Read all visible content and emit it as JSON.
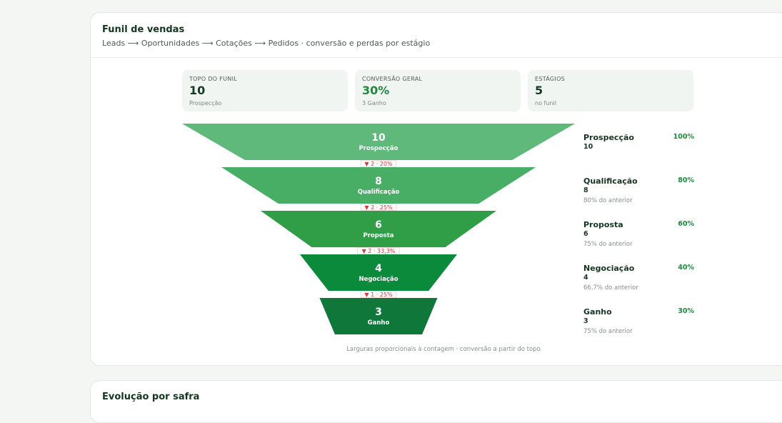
{
  "card": {
    "title": "Funil de vendas",
    "subtitle": "Leads ⟶ Oportunidades ⟶ Cotações ⟶ Pedidos · conversão e perdas por estágio"
  },
  "stats": [
    {
      "label": "TOPO DO FUNIL",
      "value": "10",
      "note": "Prospecção"
    },
    {
      "label": "CONVERSÃO GERAL",
      "value": "30%",
      "note": "3 Ganho"
    },
    {
      "label": "ESTÁGIOS",
      "value": "5",
      "note": "no funil"
    }
  ],
  "footnote": "Larguras proporcionais à contagem · conversão a partir do topo",
  "next_card": {
    "title": "Evolução por safra"
  },
  "chart_data": {
    "type": "funnel",
    "stages": [
      {
        "name": "Prospecção",
        "value": 10,
        "pct_of_top": "100%",
        "note": "",
        "color": "#5fb97a"
      },
      {
        "name": "Qualificação",
        "value": 8,
        "pct_of_top": "80%",
        "note": "80% do anterior",
        "color": "#48ae66"
      },
      {
        "name": "Proposta",
        "value": 6,
        "pct_of_top": "60%",
        "note": "75% do anterior",
        "color": "#2f9e47"
      },
      {
        "name": "Negociação",
        "value": 4,
        "pct_of_top": "40%",
        "note": "66,7% do anterior",
        "color": "#0b8a3b"
      },
      {
        "name": "Ganho",
        "value": 3,
        "pct_of_top": "30%",
        "note": "75% do anterior",
        "color": "#0f773a"
      }
    ],
    "drops": [
      "▼ 2 · 20%",
      "▼ 2 · 25%",
      "▼ 2 · 33,3%",
      "▼ 1 · 25%"
    ]
  }
}
